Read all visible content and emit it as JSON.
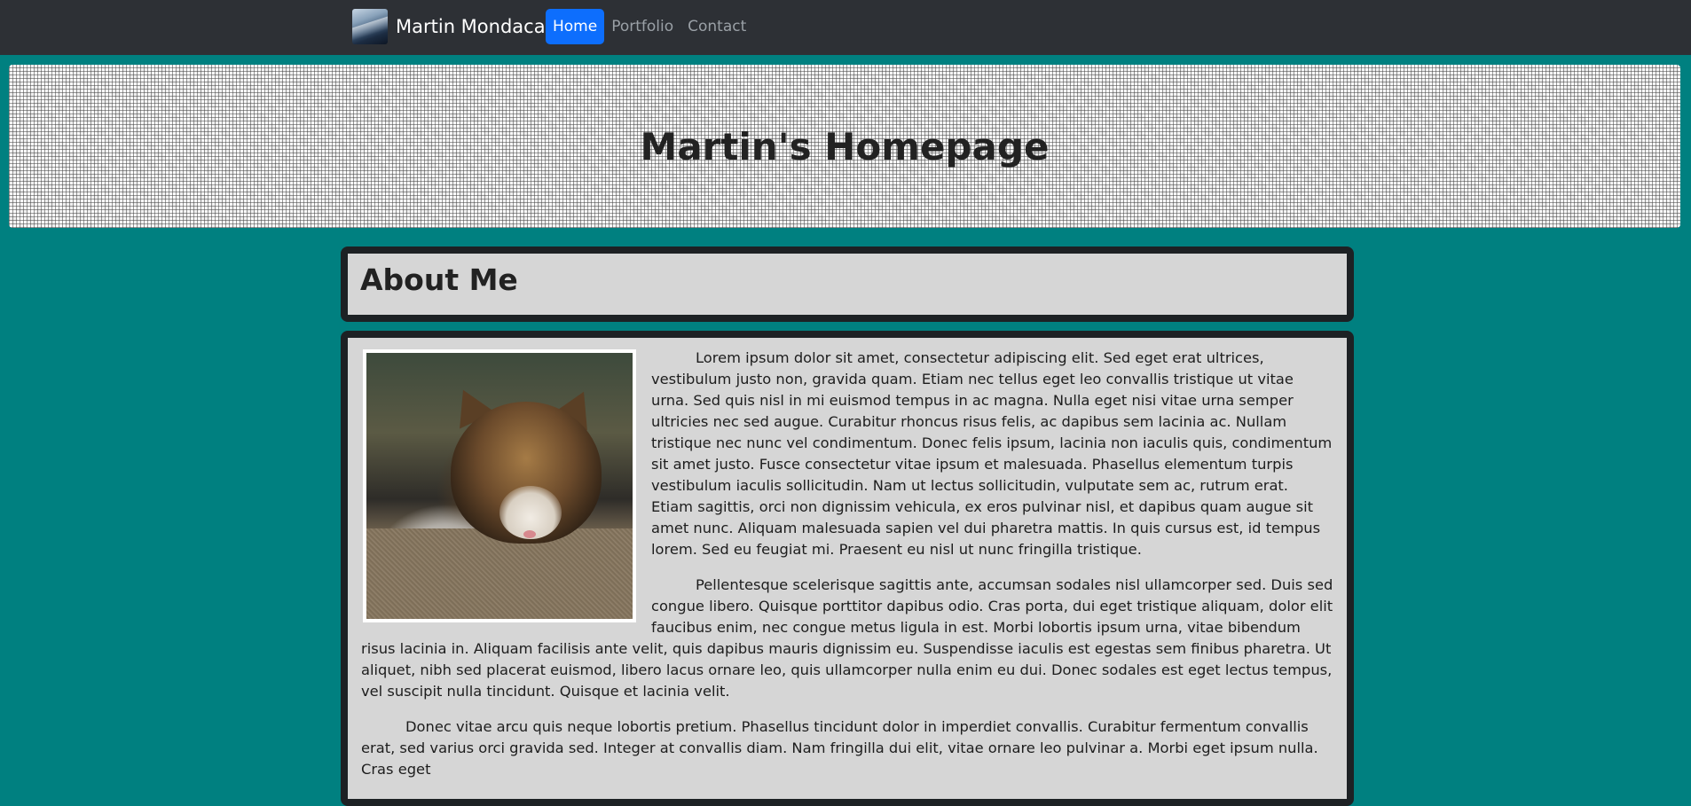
{
  "navbar": {
    "brand": "Martin Mondaca",
    "links": [
      {
        "label": "Home",
        "active": true
      },
      {
        "label": "Portfolio",
        "active": false
      },
      {
        "label": "Contact",
        "active": false
      }
    ],
    "active_color": "#0d6efd"
  },
  "banner": {
    "title": "Martin's Homepage"
  },
  "about": {
    "heading": "About Me",
    "image_alt": "kitten photo",
    "paragraphs": [
      "Lorem ipsum dolor sit amet, consectetur adipiscing elit. Sed eget erat ultrices, vestibulum justo non, gravida quam. Etiam nec tellus eget leo convallis tristique ut vitae urna. Sed quis nisl in mi euismod tempus in ac magna. Nulla eget nisi vitae urna semper ultricies nec sed augue. Curabitur rhoncus risus felis, ac dapibus sem lacinia ac. Nullam tristique nec nunc vel condimentum. Donec felis ipsum, lacinia non iaculis quis, condimentum sit amet justo. Fusce consectetur vitae ipsum et malesuada. Phasellus elementum turpis vestibulum iaculis sollicitudin. Nam ut lectus sollicitudin, vulputate sem ac, rutrum erat. Etiam sagittis, orci non dignissim vehicula, ex eros pulvinar nisl, et dapibus quam augue sit amet nunc. Aliquam malesuada sapien vel dui pharetra mattis. In quis cursus est, id tempus lorem. Sed eu feugiat mi. Praesent eu nisl ut nunc fringilla tristique.",
      "Pellentesque scelerisque sagittis ante, accumsan sodales nisl ullamcorper sed. Duis sed congue libero. Quisque porttitor dapibus odio. Cras porta, dui eget tristique aliquam, dolor elit faucibus enim, nec congue metus ligula in est. Morbi lobortis ipsum urna, vitae bibendum risus lacinia in. Aliquam facilisis ante velit, quis dapibus mauris dignissim eu. Suspendisse iaculis est egestas sem finibus pharetra. Ut aliquet, nibh sed placerat euismod, libero lacus ornare leo, quis ullamcorper nulla enim eu dui. Donec sodales est eget lectus tempus, vel suscipit nulla tincidunt. Quisque et lacinia velit.",
      "Donec vitae arcu quis neque lobortis pretium. Phasellus tincidunt dolor in imperdiet convallis. Curabitur fermentum convallis erat, sed varius orci gravida sed. Integer at convallis diam. Nam fringilla dui elit, vitae ornare leo pulvinar a. Morbi eget ipsum nulla. Cras eget"
    ]
  }
}
